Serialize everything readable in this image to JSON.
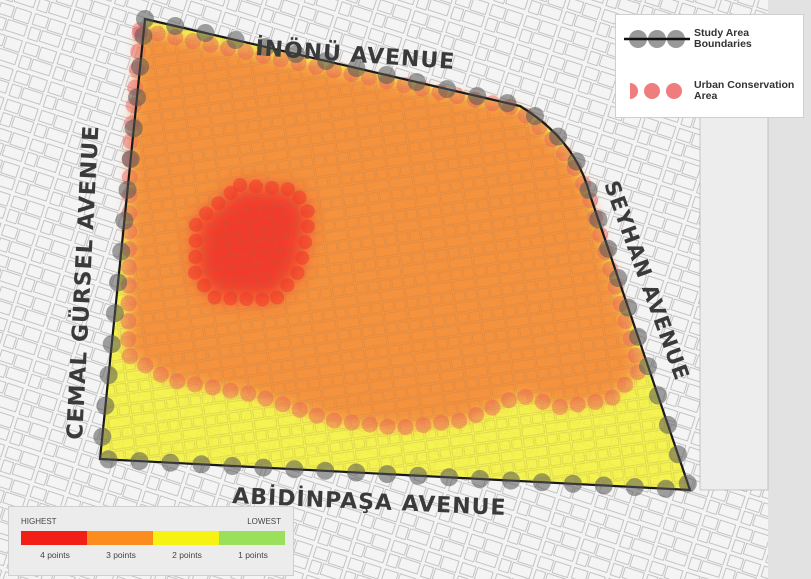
{
  "streets": {
    "north": "İNÖNÜ AVENUE",
    "east": "SEYHAN AVENUE",
    "south": "ABİDİNPAŞA AVENUE",
    "west": "CEMAL GÜRSEL AVENUE"
  },
  "legend": {
    "boundary_label": "Study Area\nBoundaries",
    "conservation_label": "Urban Conservation\nArea"
  },
  "scale": {
    "high_label": "HIGHEST",
    "low_label": "LOWEST",
    "classes": [
      {
        "label": "4 points",
        "color": "#f21f16"
      },
      {
        "label": "3 points",
        "color": "#fb8c1e"
      },
      {
        "label": "2 points",
        "color": "#f6f214"
      },
      {
        "label": "1 points",
        "color": "#9ae05b"
      }
    ]
  },
  "colors": {
    "zone_high": "#f2382a",
    "zone_medium": "#f68a3c",
    "zone_low": "#f4f23a",
    "boundary": "#1a1a1a",
    "boundary_dots": "#555555",
    "conservation_dots": "#ec5d5d",
    "basemap_lines": "#9a9a9a"
  }
}
